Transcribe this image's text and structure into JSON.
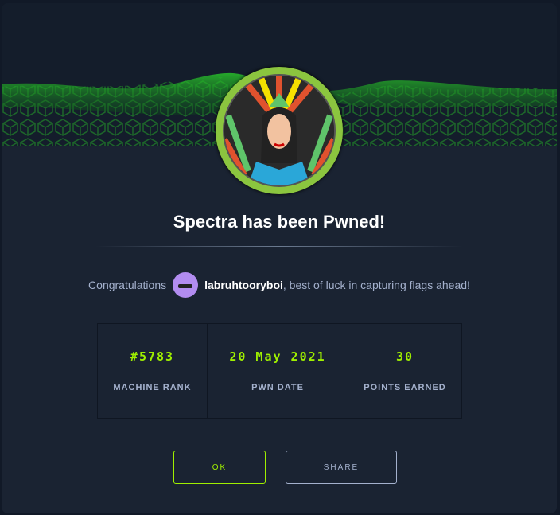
{
  "modal": {
    "title": "Spectra has been Pwned!",
    "congrats_prefix": "Congratulations",
    "username": "labruhtooryboi",
    "congrats_suffix": ", best of luck in capturing flags ahead!",
    "stats": [
      {
        "value": "#5783",
        "label": "MACHINE RANK"
      },
      {
        "value": "20 May 2021",
        "label": "PWN DATE"
      },
      {
        "value": "30",
        "label": "POINTS EARNED"
      }
    ],
    "ok_label": "OK",
    "share_label": "SHARE"
  },
  "colors": {
    "accent": "#9fef00",
    "background": "#1a2332",
    "badge_ring": "#8bc53f"
  }
}
